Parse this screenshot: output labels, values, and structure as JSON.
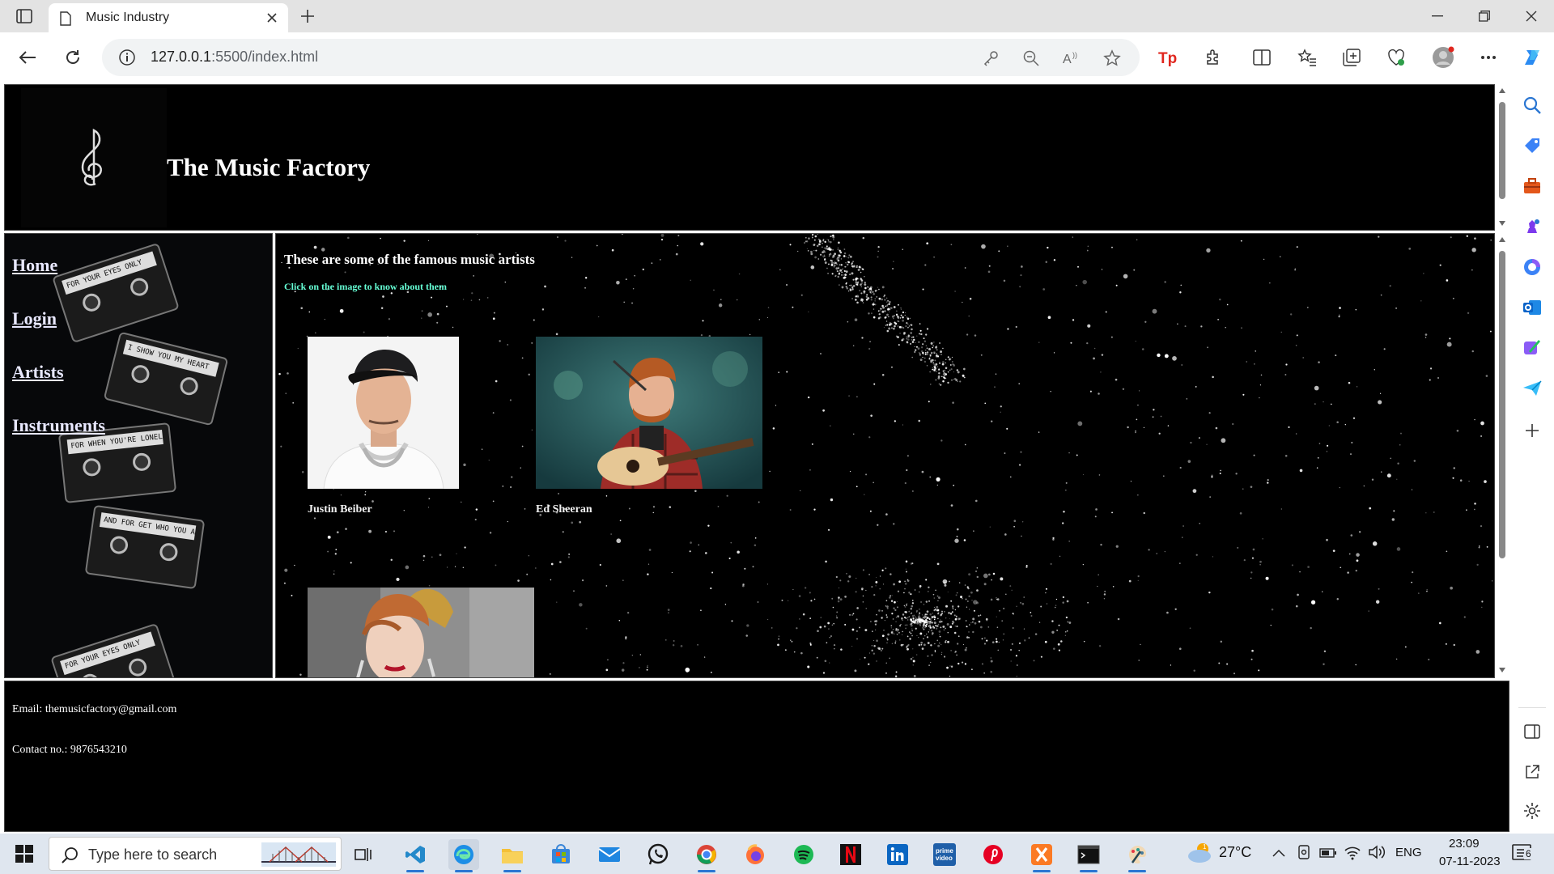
{
  "browser": {
    "tab_title": "Music Industry",
    "url_host": "127.0.0.1",
    "url_rest": ":5500/index.html"
  },
  "page": {
    "site_title": "The Music Factory",
    "nav": [
      {
        "label": "Home"
      },
      {
        "label": "Login"
      },
      {
        "label": "Artists"
      },
      {
        "label": "Instruments"
      }
    ],
    "tape_labels": [
      "FOR YOUR EYES ONLY",
      "I SHOW YOU MY HEART",
      "FOR WHEN YOU'RE LONELY",
      "AND FOR GET WHO YOU ARE",
      "FOR YOUR EYES ONLY"
    ],
    "main_heading": "These are some of the famous music artists",
    "main_subheading": "Click on the image to know about them",
    "artists": [
      {
        "name": "Justin Beiber",
        "photo": "justin-beiber-photo"
      },
      {
        "name": "Ed Sheeran",
        "photo": "ed-sheeran-photo"
      },
      {
        "name": "",
        "photo": "taylor-swift-photo"
      }
    ],
    "footer": {
      "email": "Email: themusicfactory@gmail.com",
      "contact": "Contact no.: 9876543210"
    }
  },
  "taskbar": {
    "search_placeholder": "Type here to search",
    "weather": "27°C",
    "language": "ENG",
    "time": "23:09",
    "date": "07-11-2023",
    "notification_count": "6"
  },
  "colors": {
    "page_bg": "#000000",
    "subheading": "#66ffd6",
    "nav_link": "#e8e8ff",
    "accent": "#2a76d2"
  }
}
